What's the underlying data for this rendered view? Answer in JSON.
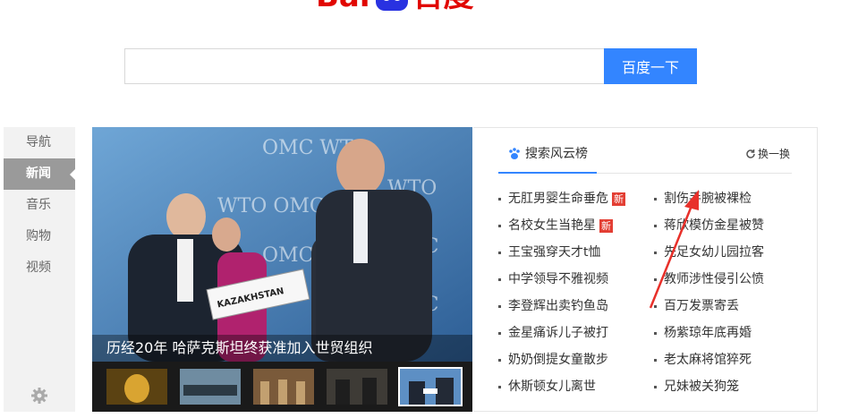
{
  "logo": {
    "text_cn": "百度",
    "text_en": "Bai"
  },
  "search": {
    "value": "",
    "placeholder": "",
    "button_label": "百度一下"
  },
  "side_nav": {
    "items": [
      {
        "label": "导航",
        "active": false
      },
      {
        "label": "新闻",
        "active": true
      },
      {
        "label": "音乐",
        "active": false
      },
      {
        "label": "购物",
        "active": false
      },
      {
        "label": "视频",
        "active": false
      }
    ],
    "settings_icon": "gear-icon"
  },
  "news": {
    "headline": "历经20年 哈萨克斯坦终获准加入世贸组织",
    "photo_sign": "KAZAKHSTAN",
    "photo_banner": "OMC  WTO",
    "selected_thumb": 5
  },
  "hot_list": {
    "tab_label": "搜索风云榜",
    "refresh_label": "换一换",
    "left": [
      {
        "text": "无肛男婴生命垂危",
        "badge": "新"
      },
      {
        "text": "名校女生当艳星",
        "badge": "新"
      },
      {
        "text": "王宝强穿天才t恤",
        "badge": ""
      },
      {
        "text": "中学领导不雅视频",
        "badge": ""
      },
      {
        "text": "李登辉出卖钓鱼岛",
        "badge": ""
      },
      {
        "text": "金星痛诉儿子被打",
        "badge": ""
      },
      {
        "text": "奶奶倒提女童散步",
        "badge": ""
      },
      {
        "text": "休斯顿女儿离世",
        "badge": ""
      }
    ],
    "right": [
      {
        "text": "割伤手腕被裸检"
      },
      {
        "text": "蒋欣模仿金星被赞"
      },
      {
        "text": "先足女幼儿园拉客"
      },
      {
        "text": "教师涉性侵引公愤"
      },
      {
        "text": "百万发票寄丢"
      },
      {
        "text": "杨紫琼年底再婚"
      },
      {
        "text": "老太麻将馆猝死"
      },
      {
        "text": "兄妹被关狗笼"
      }
    ]
  },
  "colors": {
    "brand_red": "#e10601",
    "accent_blue": "#3385ff",
    "badge_red": "#e33e33"
  }
}
